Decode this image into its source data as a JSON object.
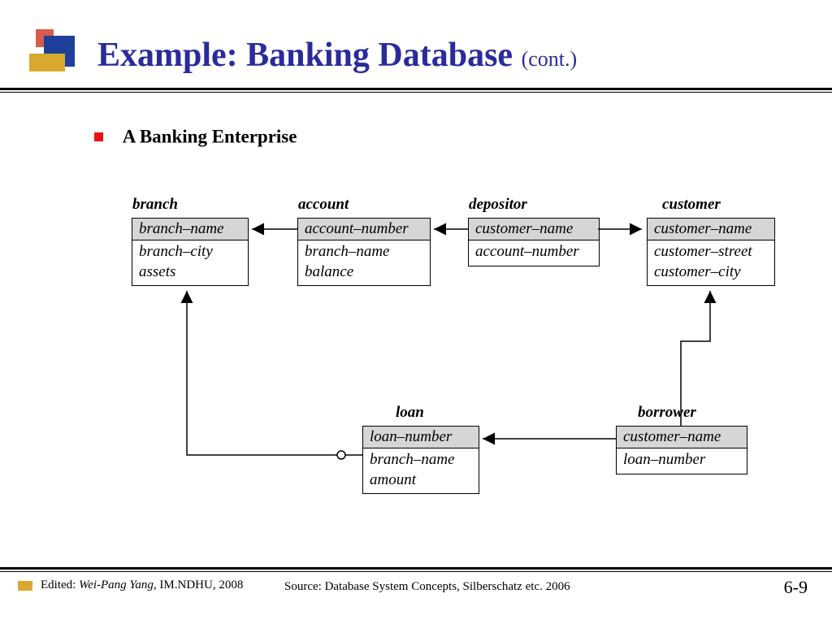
{
  "title": {
    "main": "Example: Banking Database",
    "cont": "(cont.)"
  },
  "bullet": "A Banking Enterprise",
  "tables": {
    "branch": {
      "caption": "branch",
      "pk": "branch–name",
      "attrs": [
        "branch–city",
        "assets"
      ]
    },
    "account": {
      "caption": "account",
      "pk": "account–number",
      "attrs": [
        "branch–name",
        "balance"
      ]
    },
    "depositor": {
      "caption": "depositor",
      "pk": "customer–name",
      "attrs": [
        "account–number"
      ]
    },
    "customer": {
      "caption": "customer",
      "pk": "customer–name",
      "attrs": [
        "customer–street",
        "customer–city"
      ]
    },
    "loan": {
      "caption": "loan",
      "pk": "loan–number",
      "attrs": [
        "branch–name",
        "amount"
      ]
    },
    "borrower": {
      "caption": "borrower",
      "pk": "customer–name",
      "attrs": [
        "loan–number"
      ]
    }
  },
  "footer": {
    "edited_label": "Edited:",
    "editor": "Wei-Pang Yang,",
    "affil": "IM.NDHU, 2008",
    "source": "Source: Database System Concepts, Silberschatz etc. 2006",
    "page_chapter": "6-",
    "page_number": "9"
  }
}
